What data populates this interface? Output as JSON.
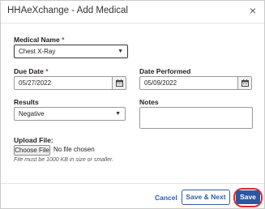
{
  "dialog": {
    "title": "HHAeXchange - Add Medical",
    "close_glyph": "×"
  },
  "form": {
    "medical_name": {
      "label": "Medical Name",
      "required_mark": "*",
      "value": "Chest X-Ray"
    },
    "due_date": {
      "label": "Due Date",
      "required_mark": "*",
      "value": "05/27/2022"
    },
    "date_performed": {
      "label": "Date Performed",
      "value": "05/09/2022"
    },
    "results": {
      "label": "Results",
      "value": "Negative"
    },
    "notes": {
      "label": "Notes",
      "value": ""
    },
    "upload": {
      "label": "Upload File:",
      "button_label": "Choose File",
      "status": "No file chosen",
      "hint": "File must be 1000 KB in size or smaller."
    }
  },
  "footer": {
    "cancel_label": "Cancel",
    "save_next_label": "Save & Next",
    "save_label": "Save"
  },
  "colors": {
    "primary": "#2b58a0",
    "link": "#2f5fa5",
    "required": "#c0392b",
    "highlight_ring": "#e0262e"
  },
  "icons": {
    "calendar": "calendar-icon",
    "chevron": "chevron-down-icon",
    "close": "close-icon"
  }
}
